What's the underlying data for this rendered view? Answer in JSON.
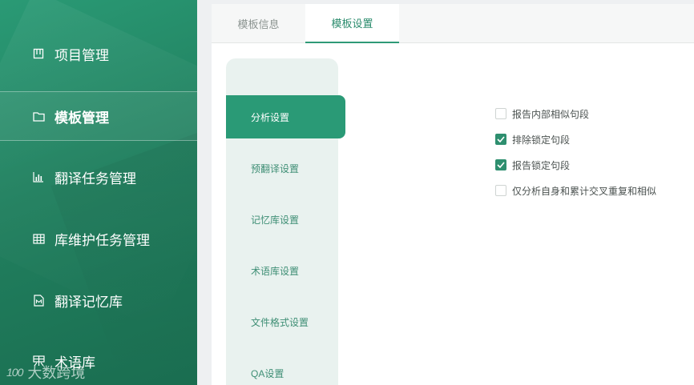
{
  "colors": {
    "sidebar": "#21805f",
    "accent": "#2a9a76",
    "submenu_bg": "#e9f2ef"
  },
  "sidebar": {
    "items": [
      {
        "label": "项目管理",
        "icon": "project-board-icon",
        "active": false
      },
      {
        "label": "模板管理",
        "icon": "folder-icon",
        "active": true
      },
      {
        "label": "翻译任务管理",
        "icon": "bar-chart-icon",
        "active": false
      },
      {
        "label": "库维护任务管理",
        "icon": "grid-table-icon",
        "active": false
      },
      {
        "label": "翻译记忆库",
        "icon": "memory-document-icon",
        "active": false
      },
      {
        "label": "术语库",
        "icon": "terminology-icon",
        "active": false
      }
    ],
    "watermark": {
      "mark": "100",
      "text": "大数跨境"
    }
  },
  "tabs": [
    {
      "label": "模板信息",
      "active": false
    },
    {
      "label": "模板设置",
      "active": true
    }
  ],
  "submenu": [
    {
      "label": "分析设置",
      "active": true
    },
    {
      "label": "预翻译设置",
      "active": false
    },
    {
      "label": "记忆库设置",
      "active": false
    },
    {
      "label": "术语库设置",
      "active": false
    },
    {
      "label": "文件格式设置",
      "active": false
    },
    {
      "label": "QA设置",
      "active": false
    }
  ],
  "options": [
    {
      "label": "报告内部相似句段",
      "checked": false
    },
    {
      "label": "排除锁定句段",
      "checked": true
    },
    {
      "label": "报告锁定句段",
      "checked": true
    },
    {
      "label": "仅分析自身和累计交叉重复和相似",
      "checked": false
    }
  ]
}
